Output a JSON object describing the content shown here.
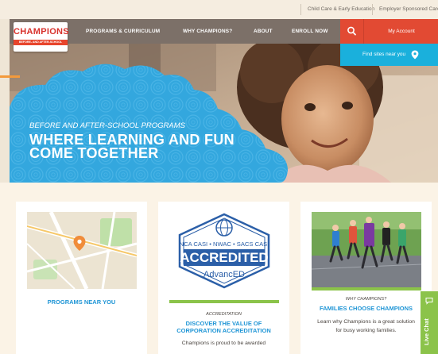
{
  "utility_nav": {
    "items": [
      "Child Care & Early Education",
      "Employer Sponsored Care"
    ]
  },
  "brand": {
    "logo_text": "CHAMPIONS",
    "logo_tagline": "BEFORE- AND AFTER-SCHOOL"
  },
  "main_nav": {
    "items": [
      "PROGRAMS & CURRICULUM",
      "WHY CHAMPIONS?",
      "ABOUT",
      "ENROLL NOW"
    ],
    "account_label": "My Account"
  },
  "find_sites": {
    "label": "Find sites near you"
  },
  "hero": {
    "eyebrow": "BEFORE AND AFTER-SCHOOL PROGRAMS",
    "headline_line1": "WHERE LEARNING AND FUN",
    "headline_line2": "COME TOGETHER"
  },
  "cards": {
    "programs": {
      "title": "PROGRAMS NEAR YOU"
    },
    "accreditation": {
      "badge_top": "NCA CASI • NWAC • SACS CASI",
      "badge_main": "ACCREDITED",
      "badge_bottom": "AdvancED",
      "eyebrow": "ACCREDITATION",
      "title_line1": "DISCOVER THE VALUE OF",
      "title_line2": "CORPORATION ACCREDITATION",
      "body": "Champions is proud to be awarded"
    },
    "families": {
      "eyebrow": "WHY CHAMPIONS?",
      "title": "FAMILIES CHOOSE CHAMPIONS",
      "body_line1": "Learn why Champions is a great solution",
      "body_line2": "for busy working families."
    }
  },
  "live_chat": {
    "label": "Live Chat"
  },
  "colors": {
    "nav_bg": "#7c7068",
    "accent_red": "#e24a33",
    "sky_blue": "#1ab0dc",
    "cloud_blue": "#33a7de",
    "cream": "#fbf3e6",
    "live_chat_green": "#8bc34a",
    "title_blue": "#2196d6"
  }
}
